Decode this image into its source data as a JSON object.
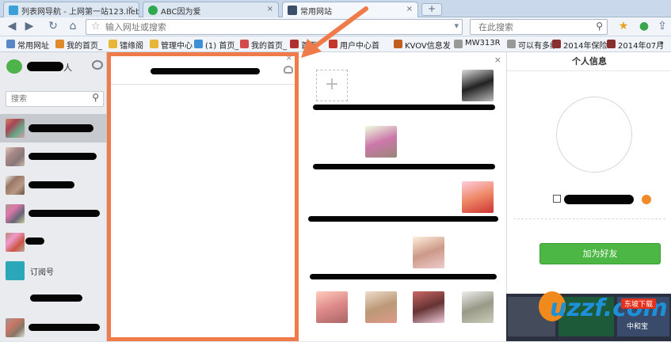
{
  "tabs": [
    {
      "label": "列表网导航 - 上网第一站123.lieb",
      "active": false
    },
    {
      "label": "ABC因为爱",
      "active": false
    },
    {
      "label": "常用网站",
      "active": true
    }
  ],
  "newtab_symbol": "+",
  "nav": {
    "url_placeholder": "输入网址或搜索",
    "search_placeholder": "在此搜索"
  },
  "bookmarks": [
    {
      "label": "常用网址",
      "color": "#5b86c5"
    },
    {
      "label": "我的首页_",
      "color": "#e08a2a"
    },
    {
      "label": "镭缘阁",
      "color": "#e8b73a"
    },
    {
      "label": "管理中心",
      "color": "#e8b73a"
    },
    {
      "label": "(1) 首页_",
      "color": "#3d8fd6"
    },
    {
      "label": "我的首页_",
      "color": "#d34b4b"
    },
    {
      "label": "首页",
      "color": "#b03030"
    },
    {
      "label": "用户中心首",
      "color": "#c0392b"
    },
    {
      "label": "KVOV信息发",
      "color": "#c06020"
    },
    {
      "label": "MW313R",
      "color": "#999999"
    },
    {
      "label": "可以有多维",
      "color": "#999999"
    },
    {
      "label": "2014年保险",
      "color": "#8a2f2f"
    },
    {
      "label": "2014年07月",
      "color": "#8a2f2f"
    }
  ],
  "wechat": {
    "header_suffix": "人",
    "search_placeholder": "搜索",
    "subscription_label": "订阅号"
  },
  "close_glyph": "×",
  "info": {
    "title": "个人信息",
    "add_friend": "加为好友"
  },
  "watermark": "uzzf.com",
  "watermark_badge": "东坡下载",
  "thumb_text": "中和宝"
}
